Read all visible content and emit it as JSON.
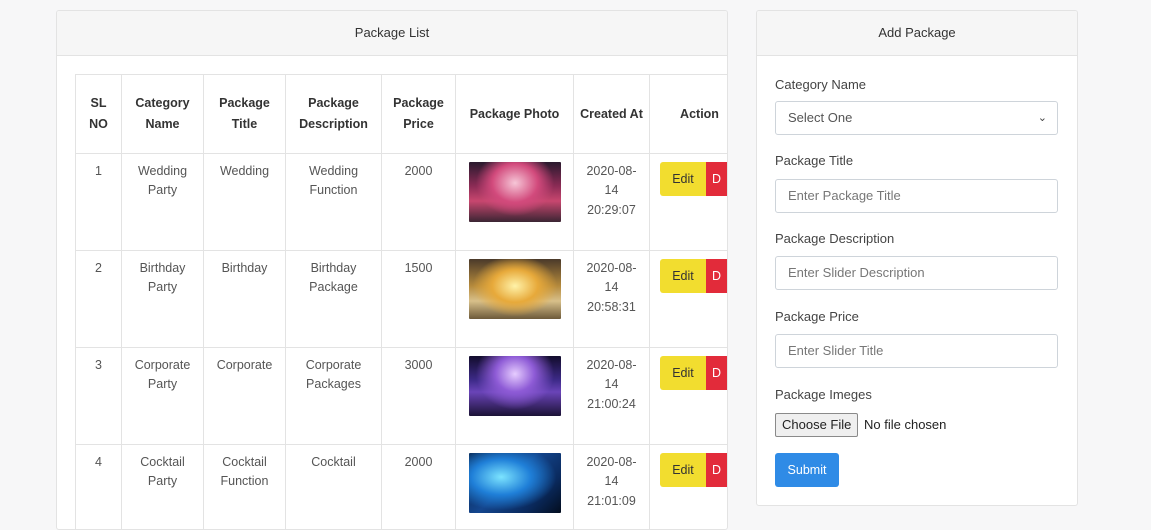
{
  "package_list": {
    "title": "Package List",
    "columns": [
      "SL NO",
      "Category Name",
      "Package Title",
      "Package Description",
      "Package Price",
      "Package Photo",
      "Created At",
      "Action"
    ],
    "rows": [
      {
        "sl": "1",
        "category": "Wedding Party",
        "title": "Wedding",
        "description": "Wedding Function",
        "price": "2000",
        "photo": "wedding-stage-photo",
        "created": "2020-08-14 20:29:07",
        "edit": "Edit",
        "delete": "D"
      },
      {
        "sl": "2",
        "category": "Birthday Party",
        "title": "Birthday",
        "description": "Birthday Package",
        "price": "1500",
        "photo": "birthday-decor-photo",
        "created": "2020-08-14 20:58:31",
        "edit": "Edit",
        "delete": "D"
      },
      {
        "sl": "3",
        "category": "Corporate Party",
        "title": "Corporate",
        "description": "Corporate Packages",
        "price": "3000",
        "photo": "corporate-hall-photo",
        "created": "2020-08-14 21:00:24",
        "edit": "Edit",
        "delete": "D"
      },
      {
        "sl": "4",
        "category": "Cocktail Party",
        "title": "Cocktail Function",
        "description": "Cocktail",
        "price": "2000",
        "photo": "cocktail-lights-photo",
        "created": "2020-08-14 21:01:09",
        "edit": "Edit",
        "delete": "D"
      }
    ]
  },
  "add_package": {
    "title": "Add Package",
    "category_label": "Category Name",
    "category_selected": "Select One",
    "title_label": "Package Title",
    "title_placeholder": "Enter Package Title",
    "description_label": "Package Description",
    "description_placeholder": "Enter Slider Description",
    "price_label": "Package Price",
    "price_placeholder": "Enter Slider Title",
    "images_label": "Package Imeges",
    "choose_file": "Choose File",
    "no_file": "No file chosen",
    "submit": "Submit"
  },
  "colors": {
    "edit": "#f2dd2f",
    "delete": "#e22b3a",
    "submit": "#2f8be6"
  }
}
